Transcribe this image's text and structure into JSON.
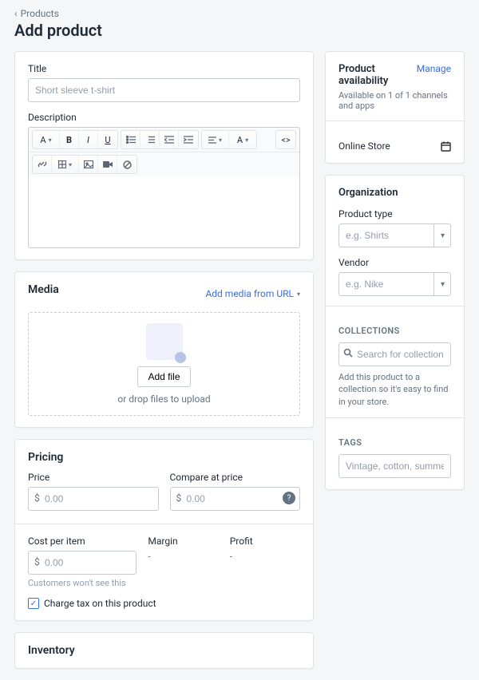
{
  "breadcrumb": {
    "back": "Products"
  },
  "header": {
    "title": "Add product"
  },
  "title_field": {
    "label": "Title",
    "placeholder": "Short sleeve t-shirt"
  },
  "description": {
    "label": "Description"
  },
  "toolbar": {
    "embed_label": "<>"
  },
  "media": {
    "heading": "Media",
    "url_link": "Add media from URL",
    "add_file": "Add file",
    "drop_hint": "or drop files to upload"
  },
  "pricing": {
    "heading": "Pricing",
    "price_label": "Price",
    "price_placeholder": "0.00",
    "compare_label": "Compare at price",
    "compare_placeholder": "0.00",
    "cost_label": "Cost per item",
    "cost_placeholder": "0.00",
    "cost_hint": "Customers won't see this",
    "margin_label": "Margin",
    "margin_value": "-",
    "profit_label": "Profit",
    "profit_value": "-",
    "tax_label": "Charge tax on this product",
    "currency_symbol": "$"
  },
  "inventory": {
    "heading": "Inventory"
  },
  "availability": {
    "heading": "Product availability",
    "manage": "Manage",
    "desc": "Available on 1 of 1 channels and apps",
    "channel": "Online Store"
  },
  "organization": {
    "heading": "Organization",
    "product_type_label": "Product type",
    "product_type_placeholder": "e.g. Shirts",
    "vendor_label": "Vendor",
    "vendor_placeholder": "e.g. Nike"
  },
  "collections": {
    "heading": "COLLECTIONS",
    "placeholder": "Search for collections",
    "hint": "Add this product to a collection so it's easy to find in your store."
  },
  "tags": {
    "heading": "TAGS",
    "placeholder": "Vintage, cotton, summer"
  }
}
